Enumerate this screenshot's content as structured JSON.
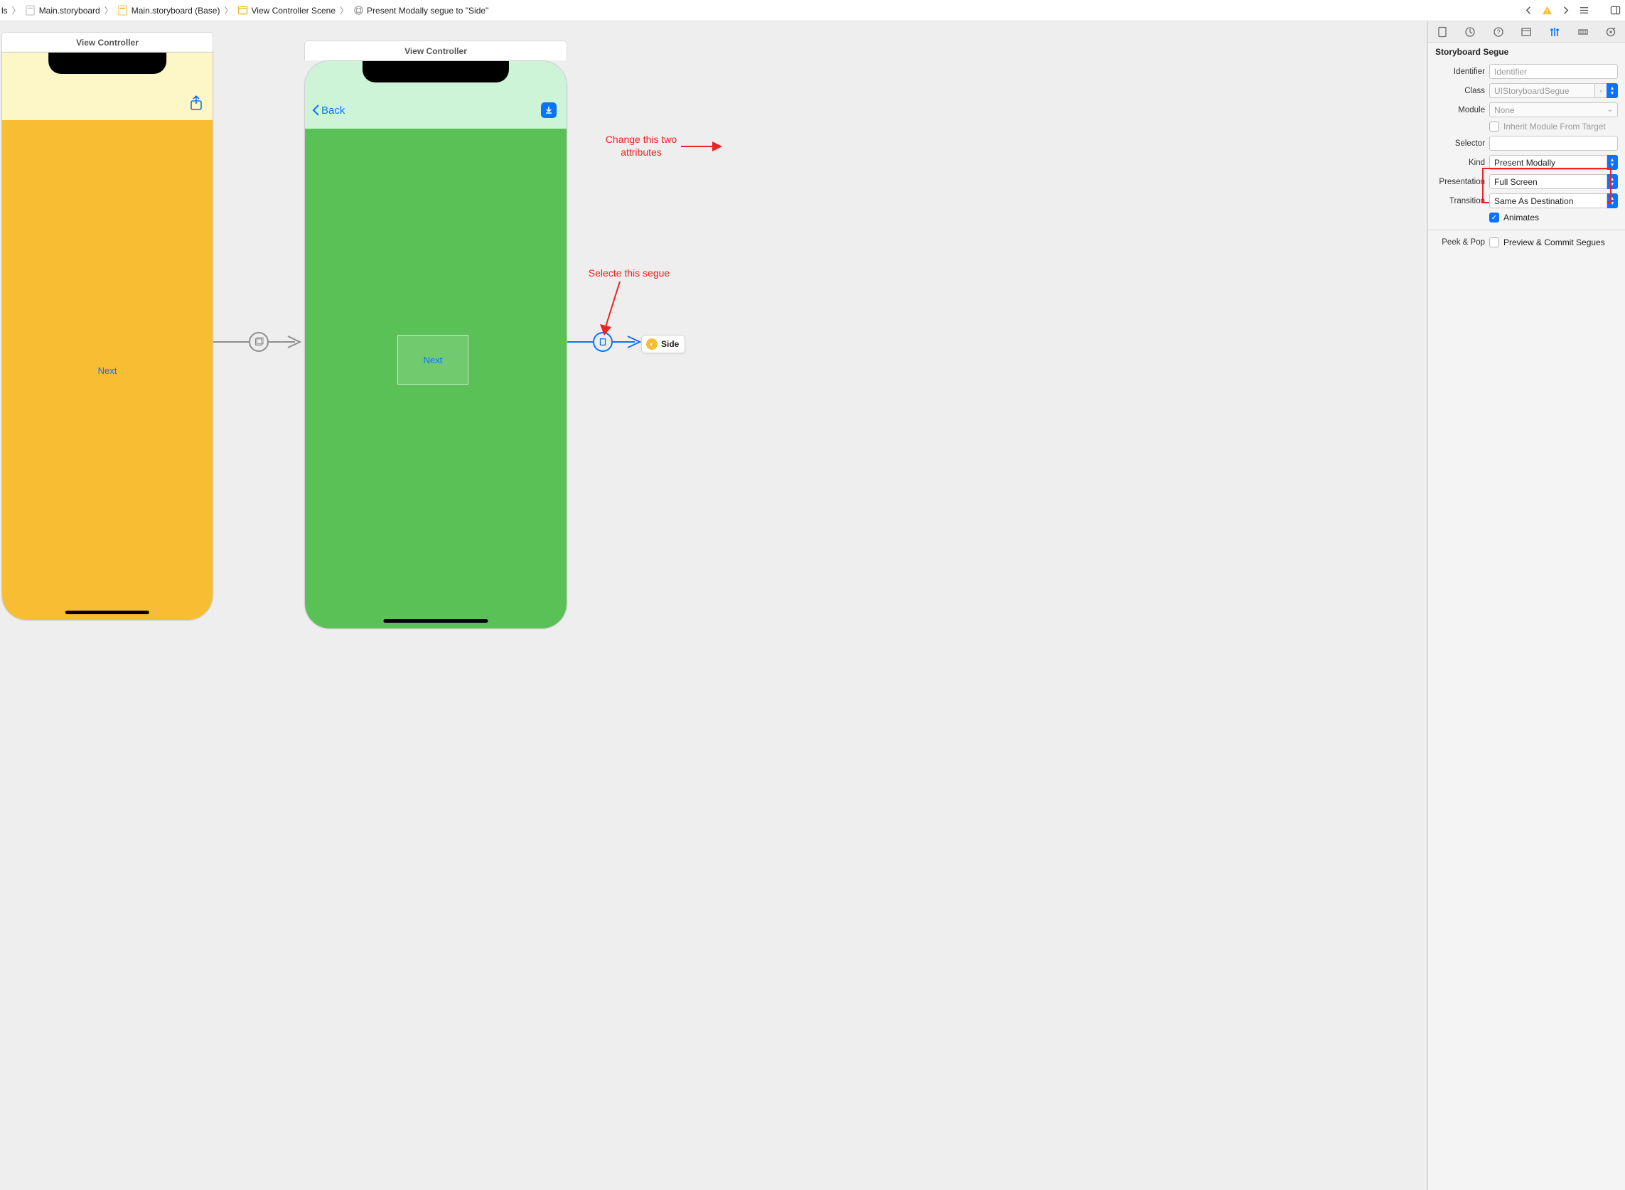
{
  "breadcrumbs": {
    "item0": "ls",
    "item1": "Main.storyboard",
    "item2": "Main.storyboard (Base)",
    "item3": "View Controller Scene",
    "item4": "Present Modally segue to \"Side\""
  },
  "canvas": {
    "scene1_title": "View Controller",
    "scene2_title": "View Controller",
    "next_label": "Next",
    "back_label": "Back",
    "container_label": "Next",
    "side_chip": "Side"
  },
  "annotations": {
    "select_segue": "Selecte this segue",
    "change_attrs_l1": "Change this two",
    "change_attrs_l2": "attributes"
  },
  "inspector": {
    "section_title": "Storyboard Segue",
    "rows": {
      "identifier_label": "Identifier",
      "identifier_placeholder": "Identifier",
      "class_label": "Class",
      "class_value": "UIStoryboardSegue",
      "module_label": "Module",
      "module_value": "None",
      "inherit_label": "Inherit Module From Target",
      "selector_label": "Selector",
      "kind_label": "Kind",
      "kind_value": "Present Modally",
      "presentation_label": "Presentation",
      "presentation_value": "Full Screen",
      "transition_label": "Transition",
      "transition_value": "Same As Destination",
      "animates_label": "Animates",
      "peekpop_label": "Peek & Pop",
      "peekpop_value": "Preview & Commit Segues"
    }
  }
}
